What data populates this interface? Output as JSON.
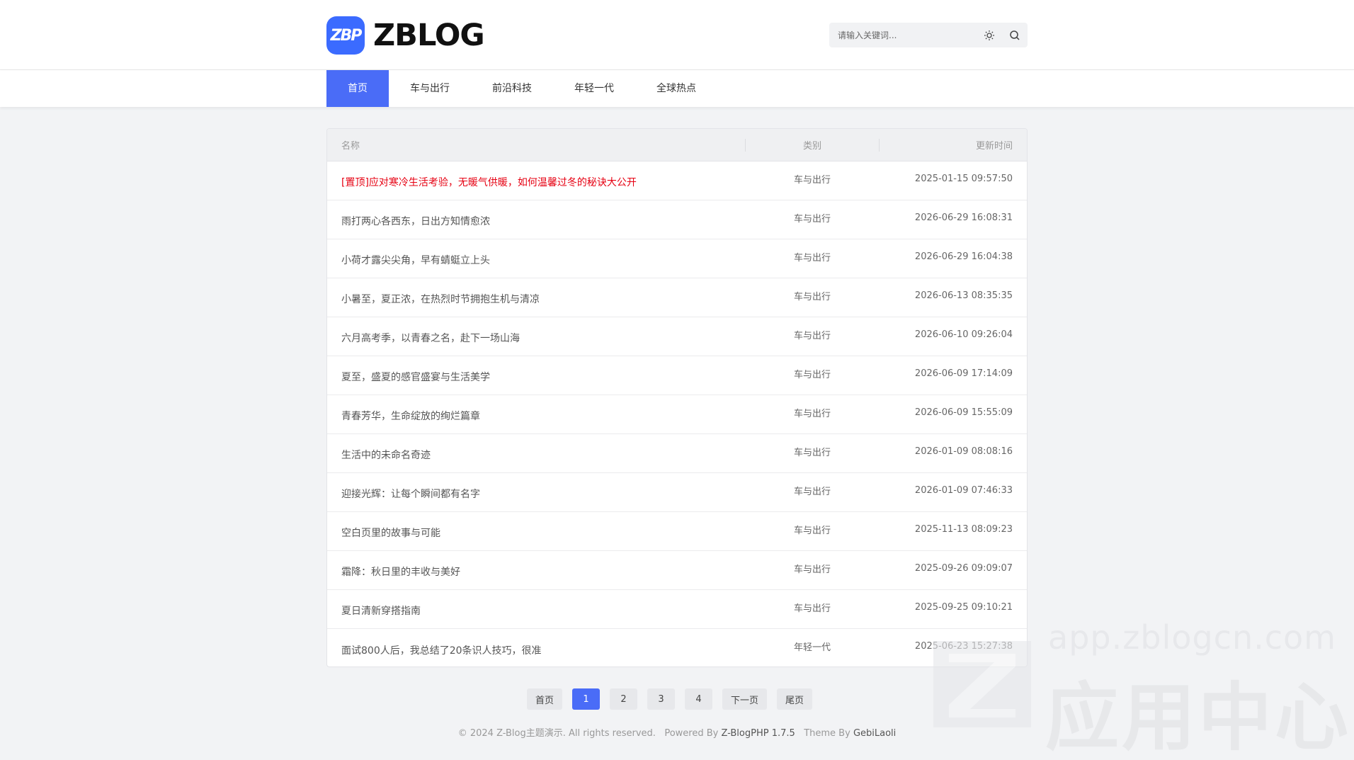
{
  "header": {
    "logo_mark": "ZBP",
    "logo_text": "ZBLOG",
    "search_placeholder": "请输入关键词..."
  },
  "nav": {
    "items": [
      {
        "label": "首页",
        "active": true
      },
      {
        "label": "车与出行"
      },
      {
        "label": "前沿科技"
      },
      {
        "label": "年轻一代"
      },
      {
        "label": "全球热点"
      }
    ]
  },
  "table": {
    "headers": {
      "name": "名称",
      "category": "类别",
      "time": "更新时间"
    },
    "rows": [
      {
        "title": "[置顶]应对寒冷生活考验，无暖气供暖，如何温馨过冬的秘诀大公开",
        "category": "车与出行",
        "time": "2025-01-15 09:57:50",
        "pinned": true
      },
      {
        "title": "雨打两心各西东，日出方知情愈浓",
        "category": "车与出行",
        "time": "2026-06-29 16:08:31"
      },
      {
        "title": "小荷才露尖尖角，早有蜻蜓立上头",
        "category": "车与出行",
        "time": "2026-06-29 16:04:38"
      },
      {
        "title": "小暑至，夏正浓，在热烈时节拥抱生机与清凉",
        "category": "车与出行",
        "time": "2026-06-13 08:35:35"
      },
      {
        "title": "六月高考季，以青春之名，赴下一场山海",
        "category": "车与出行",
        "time": "2026-06-10 09:26:04"
      },
      {
        "title": "夏至，盛夏的感官盛宴与生活美学",
        "category": "车与出行",
        "time": "2026-06-09 17:14:09"
      },
      {
        "title": "青春芳华，生命绽放的绚烂篇章",
        "category": "车与出行",
        "time": "2026-06-09 15:55:09"
      },
      {
        "title": "生活中的未命名奇迹",
        "category": "车与出行",
        "time": "2026-01-09 08:08:16"
      },
      {
        "title": "迎接光辉：让每个瞬间都有名字",
        "category": "车与出行",
        "time": "2026-01-09 07:46:33"
      },
      {
        "title": "空白页里的故事与可能",
        "category": "车与出行",
        "time": "2025-11-13 08:09:23"
      },
      {
        "title": "霜降：秋日里的丰收与美好",
        "category": "车与出行",
        "time": "2025-09-26 09:09:07"
      },
      {
        "title": "夏日清新穿搭指南",
        "category": "车与出行",
        "time": "2025-09-25 09:10:21"
      },
      {
        "title": "面试800人后，我总结了20条识人技巧，很准",
        "category": "年轻一代",
        "time": "2025-06-23 15:27:38"
      }
    ]
  },
  "pagination": {
    "first": "首页",
    "pages": [
      "1",
      "2",
      "3",
      "4"
    ],
    "current": "1",
    "next": "下一页",
    "last": "尾页"
  },
  "footer": {
    "copyright": "© 2024 Z-Blog主题演示. All rights reserved.",
    "powered_prefix": "Powered By",
    "powered_link": "Z-BlogPHP 1.7.5",
    "theme_prefix": "Theme By",
    "theme_link": "GebiLaoli"
  },
  "watermark": {
    "url": "app.zblogcn.com",
    "text": "应用中心"
  },
  "colors": {
    "accent": "#4a6cf7",
    "pinned": "#e60012",
    "logo": "#3b6bff"
  }
}
